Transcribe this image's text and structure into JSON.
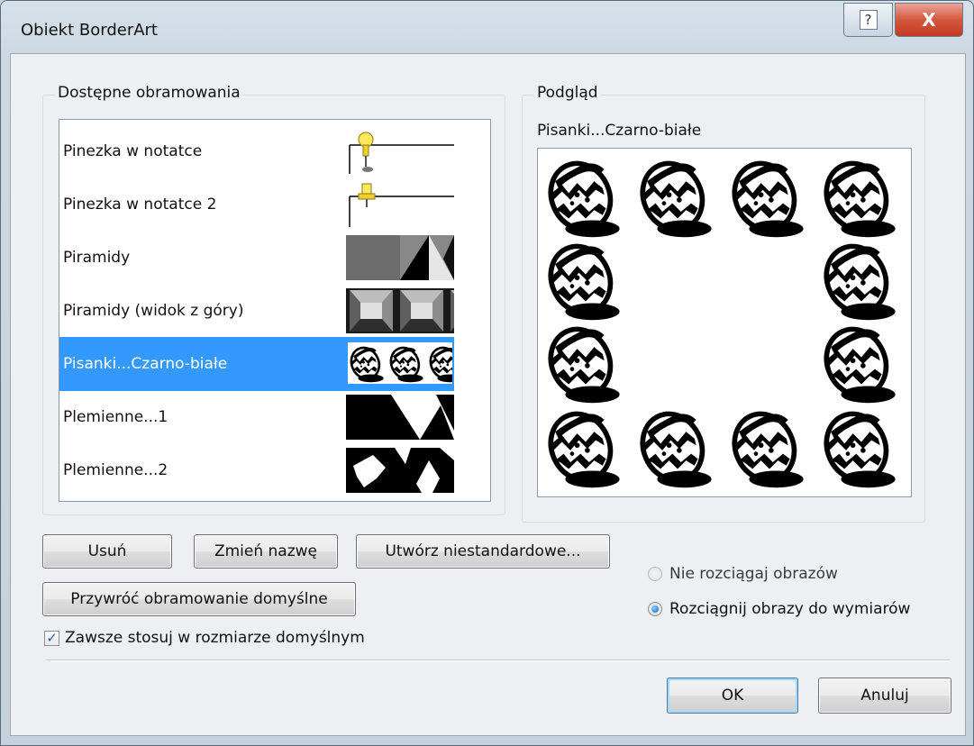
{
  "window": {
    "title": "Obiekt BorderArt",
    "help_icon": "?",
    "close_icon": "X"
  },
  "available": {
    "label": "Dostępne obramowania",
    "items": [
      {
        "label": "Pinezka w notatce",
        "thumb": "pushpin-note"
      },
      {
        "label": "Pinezka w notatce 2",
        "thumb": "pushpin-note-2"
      },
      {
        "label": "Piramidy",
        "thumb": "pyramids"
      },
      {
        "label": "Piramidy (widok z góry)",
        "thumb": "pyramids-top"
      },
      {
        "label": "Pisanki...Czarno-białe",
        "thumb": "easter-eggs-bw",
        "selected": true
      },
      {
        "label": "Plemienne...1",
        "thumb": "tribal-1"
      },
      {
        "label": "Plemienne...2",
        "thumb": "tribal-2"
      }
    ]
  },
  "preview": {
    "label": "Podgląd",
    "name": "Pisanki...Czarno-białe"
  },
  "buttons": {
    "delete": "Usuń",
    "rename": "Zmień nazwę",
    "create_custom": "Utwórz niestandardowe...",
    "restore_default": "Przywróć obramowanie domyślne",
    "ok": "OK",
    "cancel": "Anuluj"
  },
  "checkbox": {
    "label": "Zawsze stosuj w rozmiarze domyślnym",
    "checked": true
  },
  "radios": [
    {
      "label": "Nie rozciągaj obrazów",
      "selected": false
    },
    {
      "label": "Rozciągnij obrazy do wymiarów",
      "selected": true
    }
  ],
  "colors": {
    "selection": "#3399ff",
    "close_button": "#c23b22"
  }
}
